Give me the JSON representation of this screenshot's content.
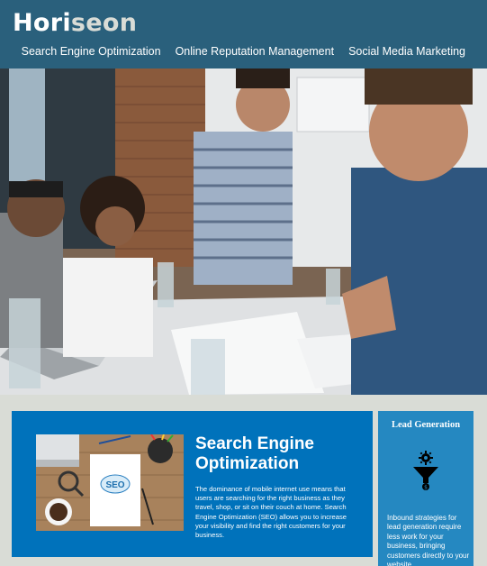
{
  "header": {
    "logo_main": "Hori",
    "logo_accent": "seon",
    "nav": [
      {
        "label": "Search Engine Optimization"
      },
      {
        "label": "Online Reputation Management"
      },
      {
        "label": "Social Media Marketing"
      }
    ]
  },
  "hero": {
    "image": "team-meeting-photo"
  },
  "seo": {
    "title": "Search Engine Optimization",
    "text": "The dominance of mobile internet use means that users are searching for the right business as they travel, shop, or sit on their couch at home. Search Engine Optimization (SEO) allows you to increase your visibility and find the right customers for your business.",
    "image": "seo-workspace-photo",
    "image_text": "SEO"
  },
  "lead": {
    "title": "Lead Generation",
    "icon": "funnel-gear-icon",
    "text": "Inbound strategies for lead generation require less work for your business, bringing customers directly to your website."
  },
  "colors": {
    "header_bg": "#2a607c",
    "page_bg": "#d9dcd6",
    "seo_card_bg": "#0072bb",
    "lead_card_bg": "#2588c1"
  }
}
